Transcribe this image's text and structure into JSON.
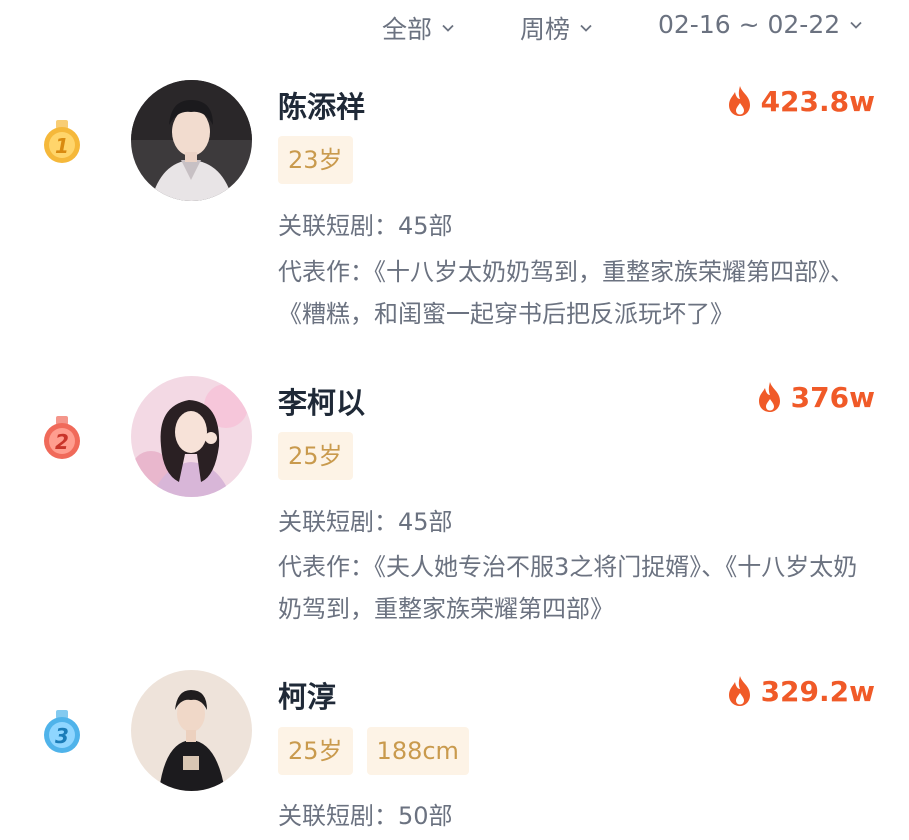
{
  "filters": {
    "category": "全部",
    "period": "周榜",
    "date_range": "02-16 ~ 02-22"
  },
  "colors": {
    "heat": "#f05a28",
    "tag_bg": "#fdf3e6",
    "tag_text": "#c99a4d",
    "medal_gold": "#f5b83a",
    "medal_red": "#f06a5a",
    "medal_blue": "#4fb3ea"
  },
  "entries": [
    {
      "rank": "1",
      "name": "陈添祥",
      "heat": "423.8w",
      "tags": [
        "23岁"
      ],
      "related": "关联短剧：45部",
      "works": "代表作：《十八岁太奶奶驾到，重整家族荣耀第四部》、《糟糕，和闺蜜一起穿书后把反派玩坏了》"
    },
    {
      "rank": "2",
      "name": "李柯以",
      "heat": "376w",
      "tags": [
        "25岁"
      ],
      "related": "关联短剧：45部",
      "works": "代表作：《夫人她专治不服3之将门捉婿》、《十八岁太奶奶驾到，重整家族荣耀第四部》"
    },
    {
      "rank": "3",
      "name": "柯淳",
      "heat": "329.2w",
      "tags": [
        "25岁",
        "188cm"
      ],
      "related": "关联短剧：50部",
      "works": ""
    }
  ]
}
